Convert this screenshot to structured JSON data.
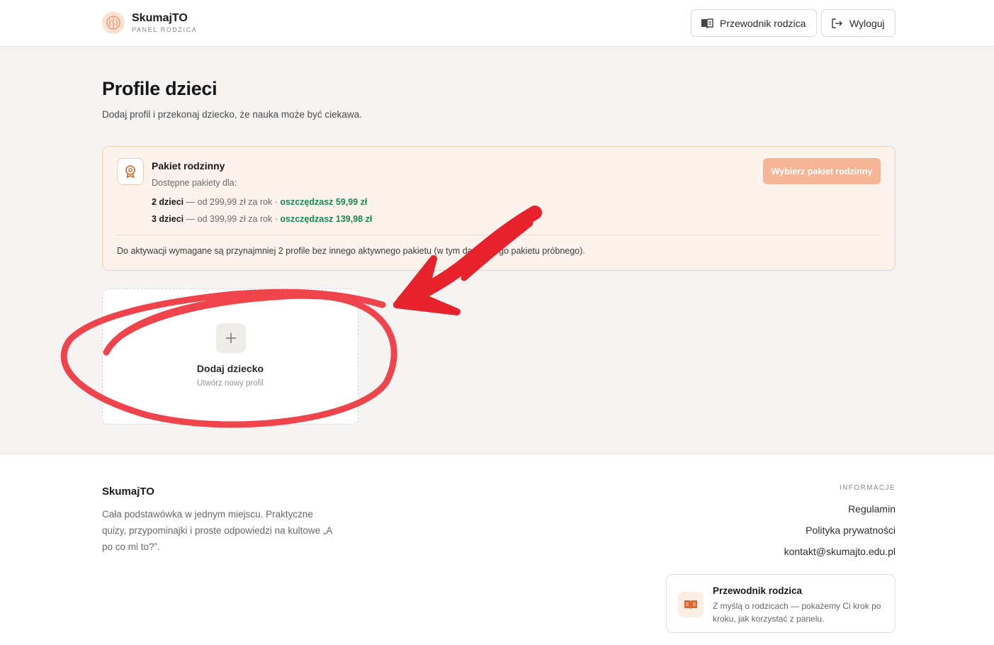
{
  "header": {
    "brand_name": "SkumajTO",
    "brand_sub": "PANEL RODZICA",
    "guide_label": "Przewodnik rodzica",
    "logout_label": "Wyloguj"
  },
  "main": {
    "title": "Profile dzieci",
    "subtitle": "Dodaj profil i przekonaj dziecko, że nauka może być ciekawa."
  },
  "promo": {
    "title": "Pakiet rodzinny",
    "available": "Dostępne pakiety dla:",
    "packages": [
      {
        "count": "2 dzieci",
        "price": " — od 299,99 zł za rok ",
        "sep": "· ",
        "save": "oszczędzasz 59,99 zł"
      },
      {
        "count": "3 dzieci",
        "price": " — od 399,99 zł za rok ",
        "sep": "· ",
        "save": "oszczędzasz 139,98 zł"
      }
    ],
    "note": "Do aktywacji wymagane są przynajmniej 2 profile bez innego aktywnego pakietu (w tym darmowego pakietu próbnego).",
    "button_label": "Wybierz pakiet rodzinny"
  },
  "add_child": {
    "plus": "+",
    "title": "Dodaj dziecko",
    "subtitle": "Utwórz nowy profil"
  },
  "footer": {
    "brand": "SkumajTO",
    "description": "Cała podstawówka w jednym miejscu. Praktyczne quizy, przypominajki i proste odpowiedzi na kultowe „A po co mi to?”.",
    "info_heading": "INFORMACJE",
    "links": [
      "Regulamin",
      "Polityka prywatności",
      "kontakt@skumajto.edu.pl"
    ],
    "guide_card": {
      "title": "Przewodnik rodzica",
      "text": "Z myślą o rodzicach — pokażemy Ci krok po kroku, jak korzystać z panelu."
    }
  },
  "colors": {
    "accent": "#e85d2a",
    "accent_soft": "#f6b597",
    "savings": "#16894c",
    "annotation": "#e8222c"
  },
  "icons": [
    "brain-icon",
    "book-icon",
    "logout-icon",
    "award-icon",
    "plus-icon",
    "open-book-icon"
  ]
}
